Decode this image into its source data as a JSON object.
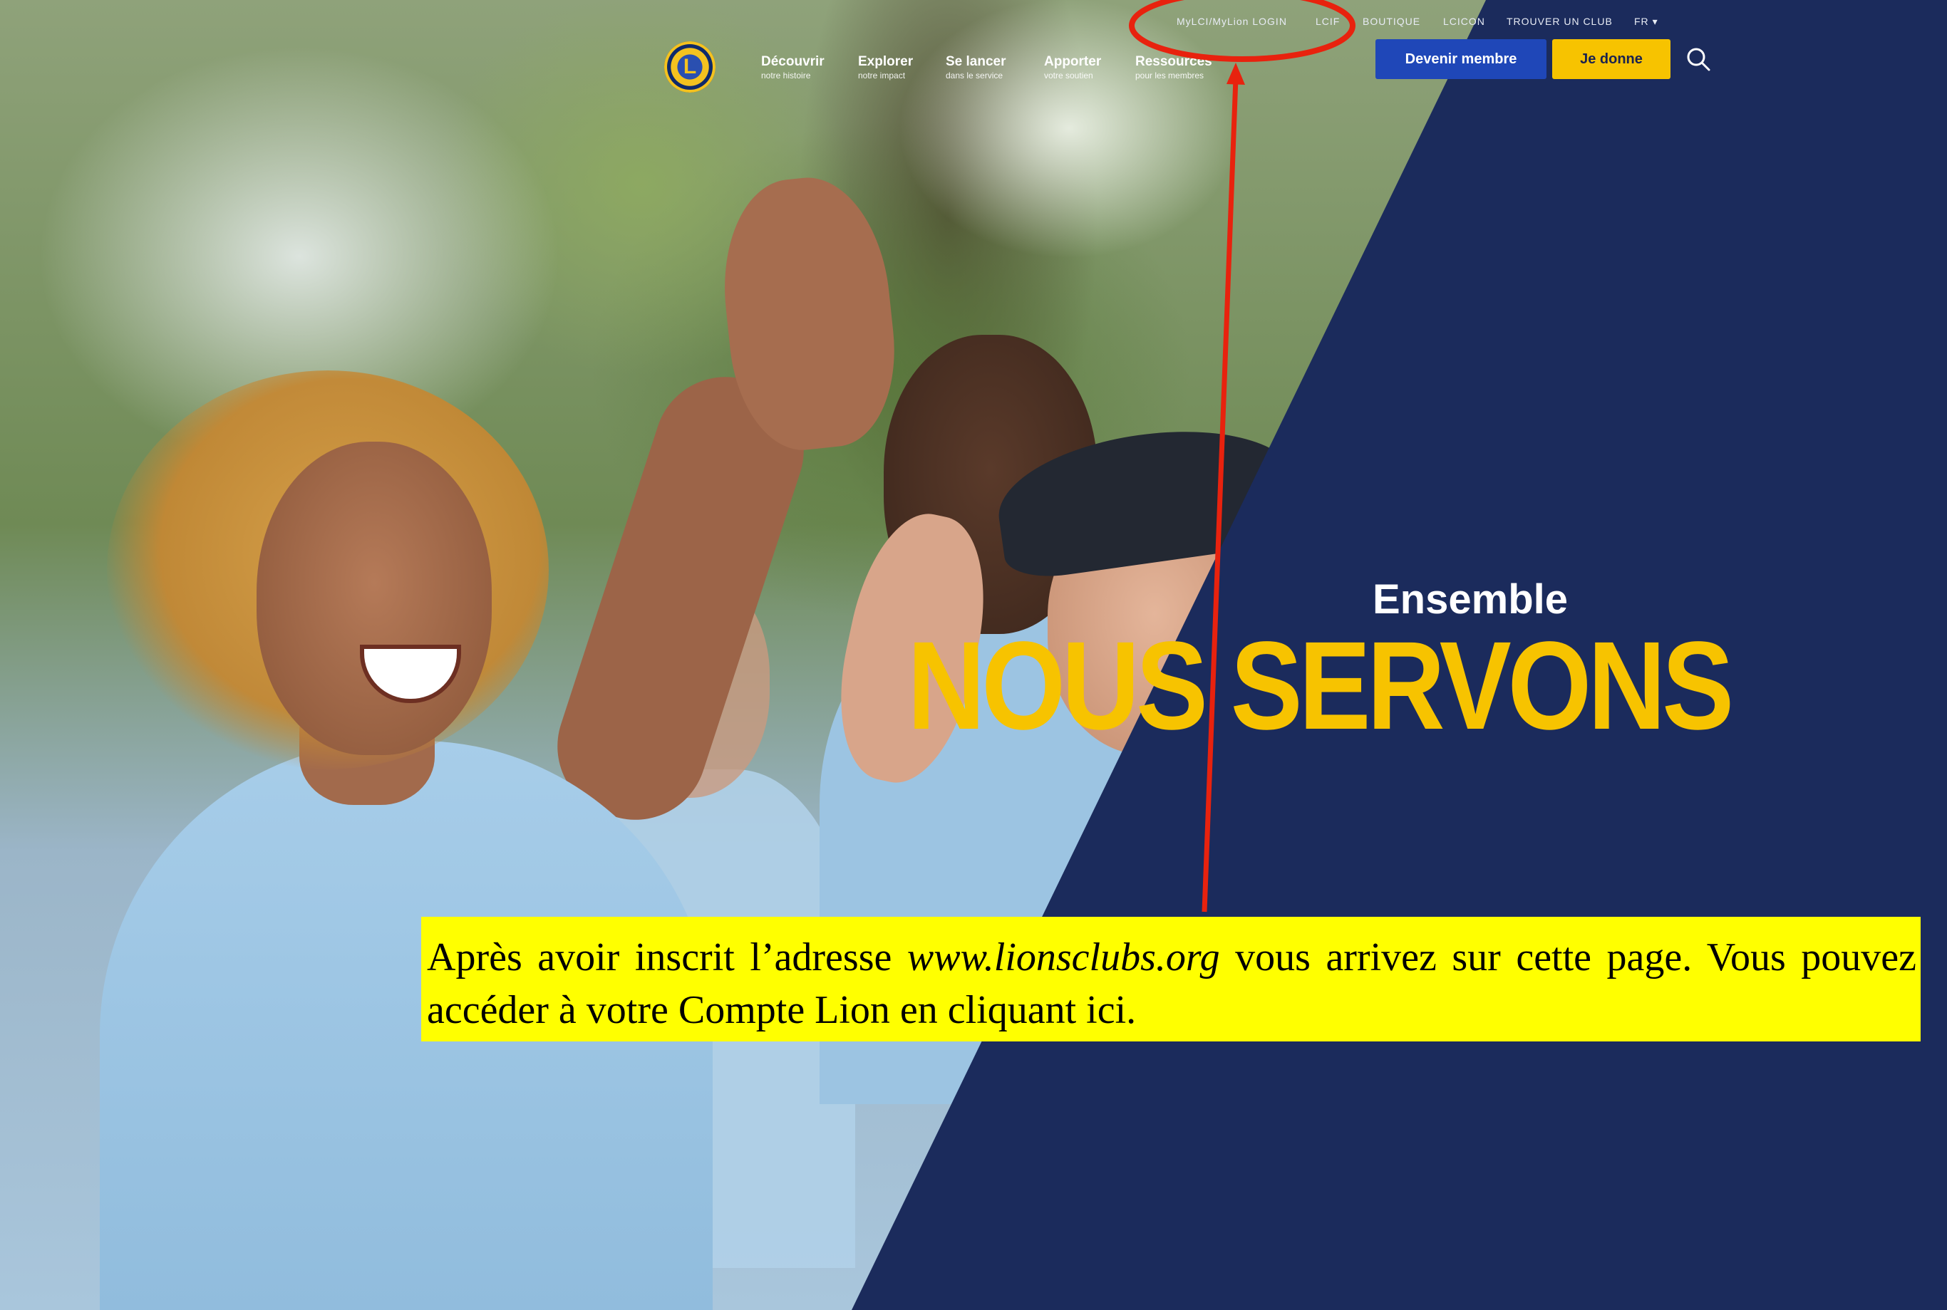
{
  "header": {
    "logo_text": "L",
    "nav": [
      {
        "title": "Découvrir",
        "sub": "notre histoire"
      },
      {
        "title": "Explorer",
        "sub": "notre impact"
      },
      {
        "title": "Se lancer",
        "sub": "dans le service"
      },
      {
        "title": "Apporter",
        "sub": "votre soutien"
      },
      {
        "title": "Ressources",
        "sub": "pour les membres"
      }
    ],
    "top_links": [
      "MyLCI/MyLion LOGIN",
      "LCIF",
      "BOUTIQUE",
      "LCICON",
      "TROUVER UN CLUB",
      "FR"
    ],
    "buttons": {
      "member": "Devenir membre",
      "donate": "Je donne"
    }
  },
  "hero": {
    "subtitle": "Ensemble",
    "title": "NOUS SERVONS"
  },
  "annotation": {
    "part1": "Après avoir inscrit l’adresse ",
    "url": "www.lionsclubs.org",
    "part2": " vous arrivez sur cette page. Vous pouvez accéder à votre Compte Lion en cliquant ici."
  },
  "colors": {
    "navy": "#1b2b5c",
    "yellow": "#f7c300",
    "blue_button": "#1f47b8",
    "annotation_red": "#e8220e",
    "annotation_bg": "#ffff00"
  }
}
